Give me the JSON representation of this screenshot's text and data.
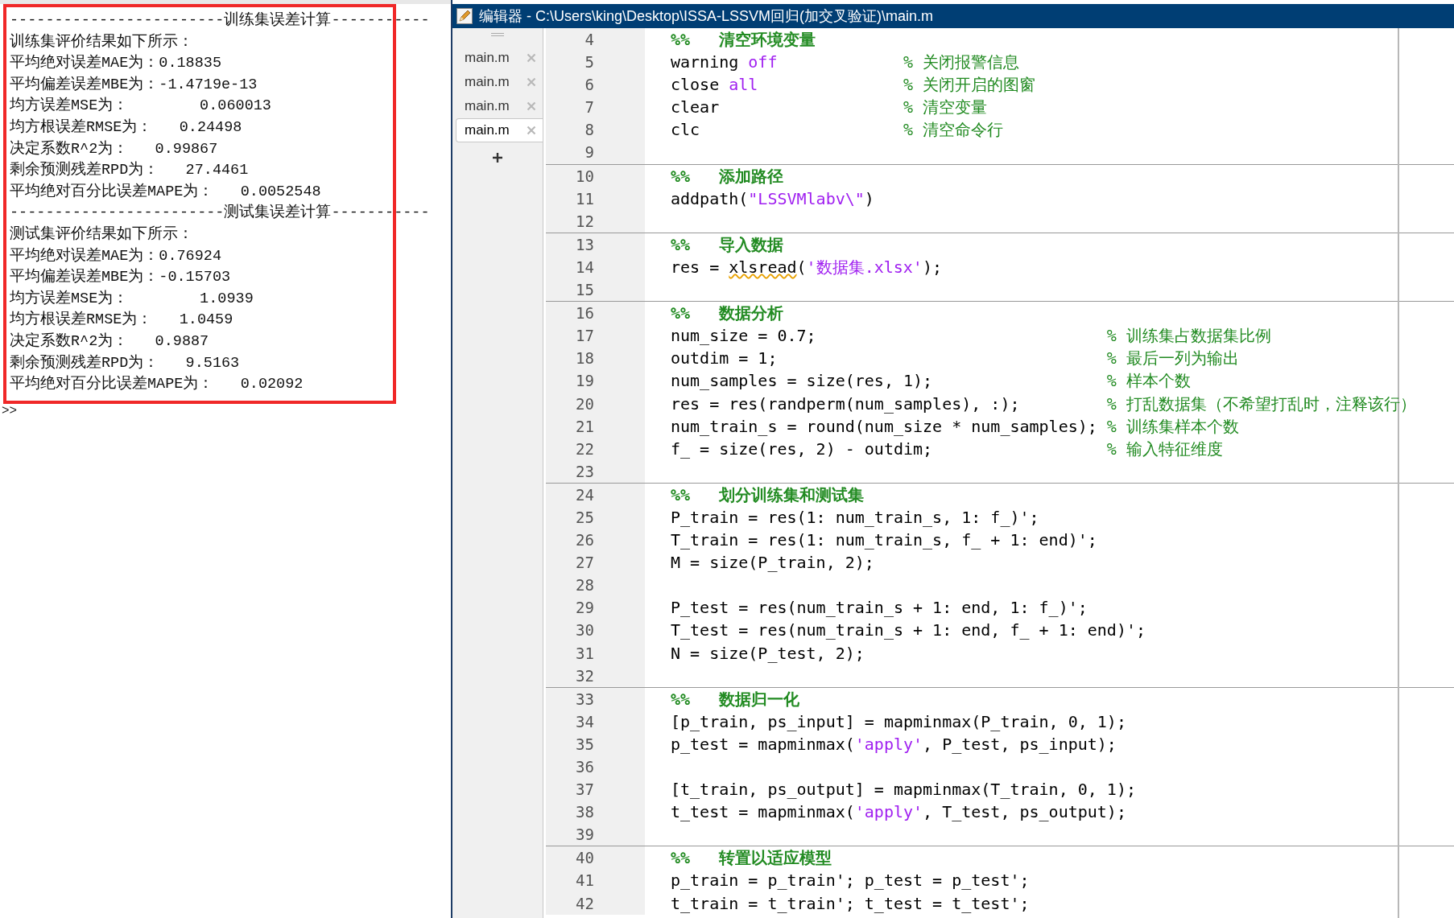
{
  "console": {
    "lines": [
      "------------------------训练集误差计算-----------",
      "训练集评价结果如下所示：",
      "平均绝对误差MAE为：0.18835",
      "平均偏差误差MBE为：-1.4719e-13",
      "均方误差MSE为：        0.060013",
      "均方根误差RMSE为：   0.24498",
      "决定系数R^2为：   0.99867",
      "剩余预测残差RPD为：   27.4461",
      "平均绝对百分比误差MAPE为：   0.0052548",
      "------------------------测试集误差计算-----------",
      "测试集评价结果如下所示：",
      "平均绝对误差MAE为：0.76924",
      "平均偏差误差MBE为：-0.15703",
      "均方误差MSE为：        1.0939",
      "均方根误差RMSE为：   1.0459",
      "决定系数R^2为：   0.9887",
      "剩余预测残差RPD为：   9.5163",
      "平均绝对百分比误差MAPE为：   0.02092"
    ],
    "prompt": ">>"
  },
  "editor": {
    "title": "编辑器 - C:\\Users\\king\\Desktop\\ISSA-LSSVM回归(加交叉验证)\\main.m",
    "tabs": [
      {
        "label": "main.m",
        "selected": false
      },
      {
        "label": "main.m",
        "selected": false
      },
      {
        "label": "main.m",
        "selected": false
      },
      {
        "label": "main.m",
        "selected": true
      }
    ],
    "sections": [
      {
        "lines": [
          {
            "number": "4",
            "tokens": [
              {
                "kind": "section",
                "text": "%%   清空环境变量"
              }
            ]
          },
          {
            "number": "5",
            "tokens": [
              {
                "kind": "code",
                "text": "warning "
              },
              {
                "kind": "string",
                "text": "off"
              },
              {
                "kind": "comment",
                "text": "             % 关闭报警信息"
              }
            ]
          },
          {
            "number": "6",
            "tokens": [
              {
                "kind": "code",
                "text": "close "
              },
              {
                "kind": "string",
                "text": "all"
              },
              {
                "kind": "comment",
                "text": "               % 关闭开启的图窗"
              }
            ]
          },
          {
            "number": "7",
            "tokens": [
              {
                "kind": "code",
                "text": "clear                   "
              },
              {
                "kind": "comment",
                "text": "% 清空变量"
              }
            ]
          },
          {
            "number": "8",
            "tokens": [
              {
                "kind": "code",
                "text": "clc                     "
              },
              {
                "kind": "comment",
                "text": "% 清空命令行"
              }
            ]
          },
          {
            "number": "9"
          }
        ]
      },
      {
        "lines": [
          {
            "number": "10",
            "tokens": [
              {
                "kind": "section",
                "text": "%%   添加路径"
              }
            ]
          },
          {
            "number": "11",
            "tokens": [
              {
                "kind": "code",
                "text": "addpath("
              },
              {
                "kind": "string",
                "text": "\"LSSVMlabv\\\""
              },
              {
                "kind": "code",
                "text": ")"
              }
            ]
          },
          {
            "number": "12"
          }
        ]
      },
      {
        "lines": [
          {
            "number": "13",
            "tokens": [
              {
                "kind": "section",
                "text": "%%   导入数据"
              }
            ]
          },
          {
            "number": "14",
            "tokens": [
              {
                "kind": "code",
                "text": "res = "
              },
              {
                "kind": "flagged",
                "text": "xlsread"
              },
              {
                "kind": "code",
                "text": "("
              },
              {
                "kind": "string",
                "text": "'数据集.xlsx'"
              },
              {
                "kind": "code",
                "text": ");"
              }
            ]
          },
          {
            "number": "15"
          }
        ]
      },
      {
        "lines": [
          {
            "number": "16",
            "tokens": [
              {
                "kind": "section",
                "text": "%%   数据分析"
              }
            ]
          },
          {
            "number": "17",
            "tokens": [
              {
                "kind": "code",
                "text": "num_size = 0.7;                              "
              },
              {
                "kind": "comment",
                "text": "% 训练集占数据集比例"
              }
            ]
          },
          {
            "number": "18",
            "tokens": [
              {
                "kind": "code",
                "text": "outdim = 1;                                  "
              },
              {
                "kind": "comment",
                "text": "% 最后一列为输出"
              }
            ]
          },
          {
            "number": "19",
            "tokens": [
              {
                "kind": "code",
                "text": "num_samples = size(res, 1);                  "
              },
              {
                "kind": "comment",
                "text": "% 样本个数"
              }
            ]
          },
          {
            "number": "20",
            "tokens": [
              {
                "kind": "code",
                "text": "res = res(randperm(num_samples), :);         "
              },
              {
                "kind": "comment",
                "text": "% 打乱数据集（不希望打乱时，注释该行）"
              }
            ]
          },
          {
            "number": "21",
            "tokens": [
              {
                "kind": "code",
                "text": "num_train_s = round(num_size * num_samples); "
              },
              {
                "kind": "comment",
                "text": "% 训练集样本个数"
              }
            ]
          },
          {
            "number": "22",
            "tokens": [
              {
                "kind": "code",
                "text": "f_ = size(res, 2) - outdim;                  "
              },
              {
                "kind": "comment",
                "text": "% 输入特征维度"
              }
            ]
          },
          {
            "number": "23"
          }
        ]
      },
      {
        "lines": [
          {
            "number": "24",
            "tokens": [
              {
                "kind": "section",
                "text": "%%   划分训练集和测试集"
              }
            ]
          },
          {
            "number": "25",
            "tokens": [
              {
                "kind": "code",
                "text": "P_train = res(1: num_train_s, 1: f_)';"
              }
            ]
          },
          {
            "number": "26",
            "tokens": [
              {
                "kind": "code",
                "text": "T_train = res(1: num_train_s, f_ + 1: end)';"
              }
            ]
          },
          {
            "number": "27",
            "tokens": [
              {
                "kind": "code",
                "text": "M = size(P_train, 2);"
              }
            ]
          },
          {
            "number": "28"
          },
          {
            "number": "29",
            "tokens": [
              {
                "kind": "code",
                "text": "P_test = res(num_train_s + 1: end, 1: f_)';"
              }
            ]
          },
          {
            "number": "30",
            "tokens": [
              {
                "kind": "code",
                "text": "T_test = res(num_train_s + 1: end, f_ + 1: end)';"
              }
            ]
          },
          {
            "number": "31",
            "tokens": [
              {
                "kind": "code",
                "text": "N = size(P_test, 2);"
              }
            ]
          },
          {
            "number": "32"
          }
        ]
      },
      {
        "lines": [
          {
            "number": "33",
            "tokens": [
              {
                "kind": "section",
                "text": "%%   数据归一化"
              }
            ]
          },
          {
            "number": "34",
            "tokens": [
              {
                "kind": "code",
                "text": "[p_train, ps_input] = mapminmax(P_train, 0, 1);"
              }
            ]
          },
          {
            "number": "35",
            "tokens": [
              {
                "kind": "code",
                "text": "p_test = mapminmax("
              },
              {
                "kind": "string",
                "text": "'apply'"
              },
              {
                "kind": "code",
                "text": ", P_test, ps_input);"
              }
            ]
          },
          {
            "number": "36"
          },
          {
            "number": "37",
            "tokens": [
              {
                "kind": "code",
                "text": "[t_train, ps_output] = mapminmax(T_train, 0, 1);"
              }
            ]
          },
          {
            "number": "38",
            "tokens": [
              {
                "kind": "code",
                "text": "t_test = mapminmax("
              },
              {
                "kind": "string",
                "text": "'apply'"
              },
              {
                "kind": "code",
                "text": ", T_test, ps_output);"
              }
            ]
          },
          {
            "number": "39"
          }
        ]
      },
      {
        "lines": [
          {
            "number": "40",
            "tokens": [
              {
                "kind": "section",
                "text": "%%   转置以适应模型"
              }
            ]
          },
          {
            "number": "41",
            "tokens": [
              {
                "kind": "code",
                "text": "p_train = p_train'; p_test = p_test';"
              }
            ]
          },
          {
            "number": "42",
            "tokens": [
              {
                "kind": "code",
                "text": "t_train = t_train'; t_test = t_test';"
              }
            ]
          }
        ]
      }
    ]
  }
}
